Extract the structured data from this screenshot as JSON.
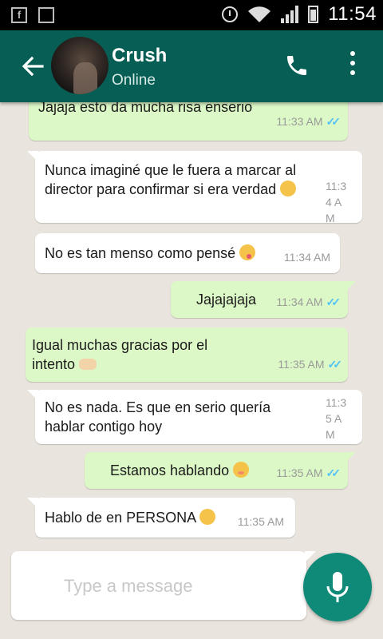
{
  "status_bar": {
    "time": "11:54"
  },
  "header": {
    "contact_name": "Crush",
    "presence": "Online"
  },
  "colors": {
    "header": "#075e54",
    "outgoing": "#dcf8c6",
    "incoming": "#ffffff",
    "mic_button": "#0f8a78",
    "read_ticks": "#4fc3f7"
  },
  "messages": [
    {
      "direction": "out",
      "text": "Jajaja esto da mucha risa enserio",
      "time": "11:33 AM",
      "read": true
    },
    {
      "direction": "in",
      "text": "Nunca imaginé que le fuera a marcar al director para confirmar si era verdad",
      "emoji": "unamused-face",
      "time": "11:34 AM"
    },
    {
      "direction": "in",
      "text": "No es tan menso como pensé",
      "emoji": "winking-face-with-tongue",
      "time": "11:34 AM"
    },
    {
      "direction": "out",
      "text": "Jajajajaja",
      "time": "11:34 AM",
      "read": true
    },
    {
      "direction": "out",
      "text": "Igual muchas gracias por el intento",
      "emoji": "raised-hands",
      "time": "11:35 AM",
      "read": true
    },
    {
      "direction": "in",
      "text": "No es nada. Es que en serio quería hablar contigo hoy",
      "time": "11:35 AM"
    },
    {
      "direction": "out",
      "text": "Estamos hablando",
      "emoji": "flushed-face",
      "time": "11:35 AM",
      "read": true
    },
    {
      "direction": "in",
      "text": "Hablo de en PERSONA",
      "emoji": "unamused-face",
      "time": "11:35 AM"
    }
  ],
  "composer": {
    "placeholder": "Type a message"
  },
  "icons": [
    "back-arrow-icon",
    "phone-icon",
    "more-vert-icon",
    "mic-icon",
    "checkmark-double-icon"
  ]
}
